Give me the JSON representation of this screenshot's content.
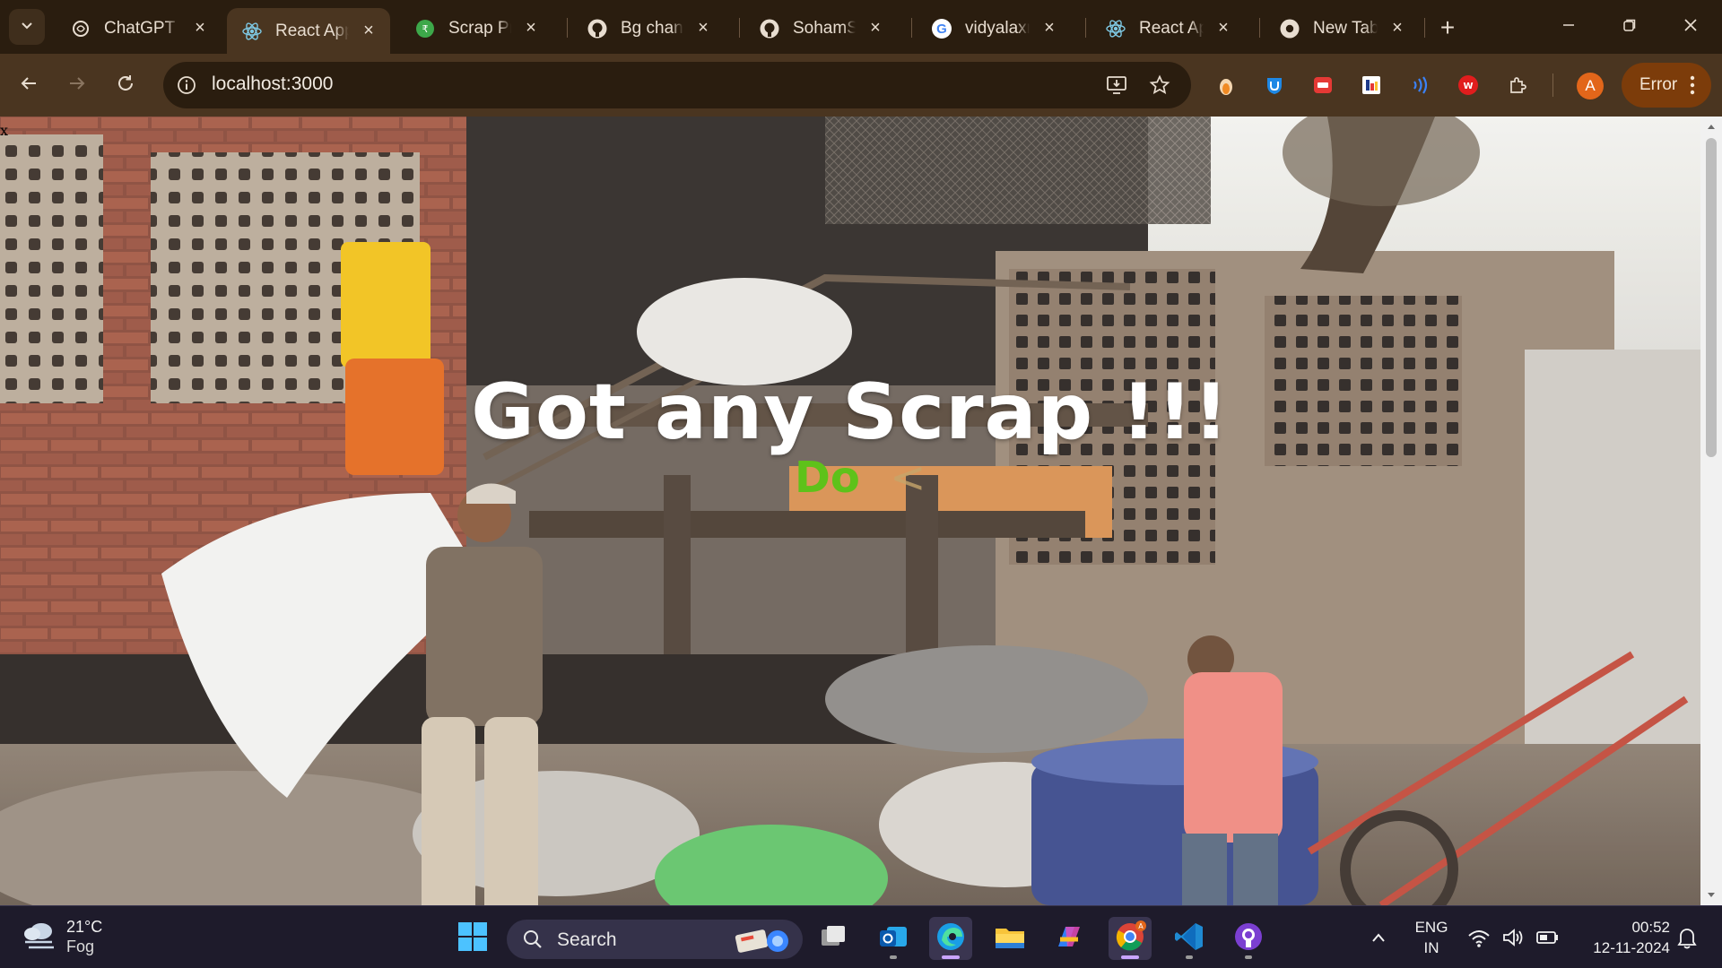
{
  "browser": {
    "tabs": [
      {
        "title": "ChatGPT",
        "icon": "chatgpt-icon",
        "active": false
      },
      {
        "title": "React App",
        "icon": "react-icon",
        "active": true
      },
      {
        "title": "Scrap Price",
        "icon": "scrap-price-icon",
        "active": false
      },
      {
        "title": "Bg changer",
        "icon": "github-icon",
        "active": false
      },
      {
        "title": "SohamSharma",
        "icon": "github-icon",
        "active": false
      },
      {
        "title": "vidyalaxmi",
        "icon": "google-icon",
        "active": false
      },
      {
        "title": "React App",
        "icon": "react-icon",
        "active": false
      },
      {
        "title": "New Tab",
        "icon": "chrome-icon",
        "active": false
      }
    ],
    "url": "localhost:3000",
    "profile_initial": "A",
    "error_label": "Error",
    "theme_colors": {
      "tabstrip": "#2a1d0f",
      "toolbar": "#4a3520"
    }
  },
  "page": {
    "corner_text": "x",
    "hero_title": "Got any Scrap !!!",
    "hero_subtitle": "Do",
    "hero_caret": "<",
    "subtitle_color": "#5ec21a",
    "background_description_icon": "scrapyard-photo"
  },
  "taskbar": {
    "weather": {
      "temp": "21°C",
      "condition": "Fog"
    },
    "search_label": "Search",
    "apps": [
      "windows-start-icon",
      "task-view-icon",
      "outlook-icon",
      "edge-icon",
      "file-explorer-icon",
      "copilot-icon",
      "chrome-icon",
      "vscode-icon",
      "github-desktop-icon"
    ],
    "lang_top": "ENG",
    "lang_bottom": "IN",
    "time": "00:52",
    "date": "12-11-2024"
  }
}
